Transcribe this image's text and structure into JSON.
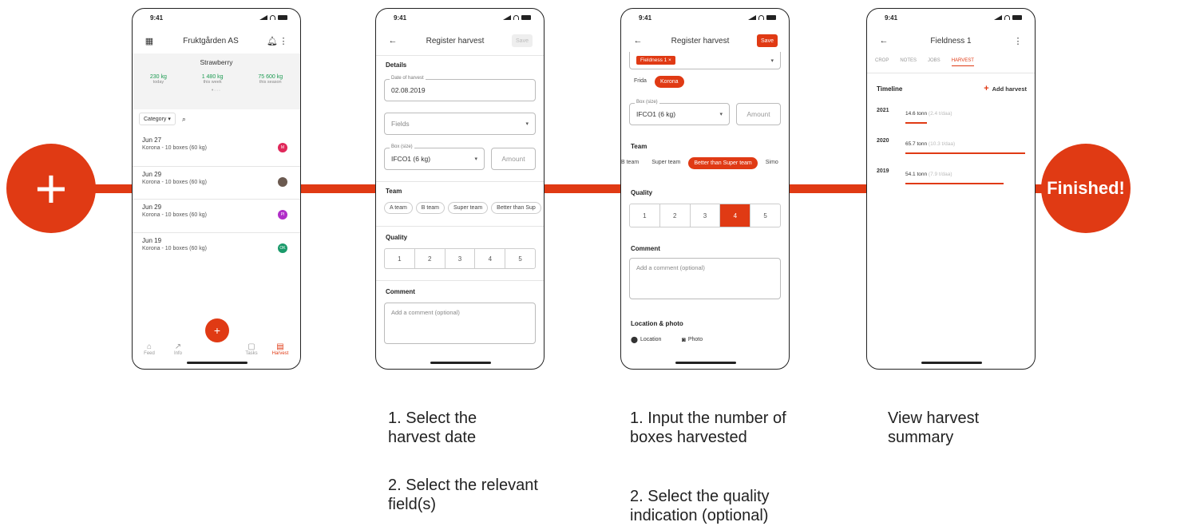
{
  "colors": {
    "accent": "#e03a14"
  },
  "flow": {
    "start_icon": "+",
    "finish_label": "Finished!"
  },
  "status_time": "9:41",
  "screen1": {
    "title": "Fruktgården AS",
    "crop": "Strawberry",
    "stats": [
      {
        "value": "230 kg",
        "label": "today"
      },
      {
        "value": "1 480 kg",
        "label": "this week"
      },
      {
        "value": "75 600 kg",
        "label": "this season"
      }
    ],
    "filter_label": "Category ▾",
    "entries": [
      {
        "date": "Jun 27",
        "detail": "Korona - 10 boxes (60 kg)",
        "avatar": "M",
        "color": "#e0285a"
      },
      {
        "date": "Jun 29",
        "detail": "Korona - 10 boxes (60 kg)",
        "avatar": "",
        "color": "#6b5a50"
      },
      {
        "date": "Jun 29",
        "detail": "Korona - 10 boxes (60 kg)",
        "avatar": "PI",
        "color": "#b02ec8"
      },
      {
        "date": "Jun 19",
        "detail": "Korona - 10 boxes (60 kg)",
        "avatar": "OK",
        "color": "#1a9a6a"
      }
    ],
    "nav": [
      "Feed",
      "Info",
      "",
      "Tasks",
      "Harvest"
    ],
    "fab": "+"
  },
  "screen2": {
    "title": "Register harvest",
    "save": "Save",
    "details_label": "Details",
    "date_label": "Date of harvest",
    "date_value": "02.08.2019",
    "fields_placeholder": "Fields",
    "box_label": "Box (size)",
    "box_value": "IFCO1 (6 kg)",
    "amount_placeholder": "Amount",
    "team_label": "Team",
    "teams": [
      "A team",
      "B team",
      "Super team",
      "Better than Sup"
    ],
    "quality_label": "Quality",
    "quality": [
      "1",
      "2",
      "3",
      "4",
      "5"
    ],
    "comment_label": "Comment",
    "comment_placeholder": "Add a comment (optional)"
  },
  "screen3": {
    "title": "Register harvest",
    "save": "Save",
    "field_tag": "Fieldness 1 ×",
    "varieties": [
      "Frida",
      "Korona"
    ],
    "box_label": "Box (size)",
    "box_value": "IFCO1 (6 kg)",
    "amount_placeholder": "Amount",
    "team_label": "Team",
    "teams": [
      "B team",
      "Super team",
      "Better than Super team",
      "Simo"
    ],
    "quality_label": "Quality",
    "quality": [
      "1",
      "2",
      "3",
      "4",
      "5"
    ],
    "comment_label": "Comment",
    "comment_placeholder": "Add a comment (optional)",
    "location_label": "Location & photo",
    "location_btn": "Location",
    "photo_btn": "Photo"
  },
  "screen4": {
    "title": "Fieldness 1",
    "tabs": [
      "CROP",
      "NOTES",
      "JOBS",
      "HARVEST"
    ],
    "timeline_label": "Timeline",
    "add_harvest": "Add harvest",
    "years": [
      {
        "year": "2021",
        "value": "14.6 tonn",
        "sub": "(2.4 t/daa)",
        "bar": 0.18
      },
      {
        "year": "2020",
        "value": "65.7 tonn",
        "sub": "(10.3 t/daa)",
        "bar": 1.0
      },
      {
        "year": "2019",
        "value": "54.1 tonn",
        "sub": "(7.9 t/daa)",
        "bar": 0.82
      }
    ]
  },
  "captions": {
    "c1a": "1. Select the harvest date",
    "c1b": "2. Select the relevant field(s)",
    "c2a": "1. Input the number of boxes harvested",
    "c2b": "2. Select the quality indication (optional)",
    "c3": "View harvest summary"
  }
}
